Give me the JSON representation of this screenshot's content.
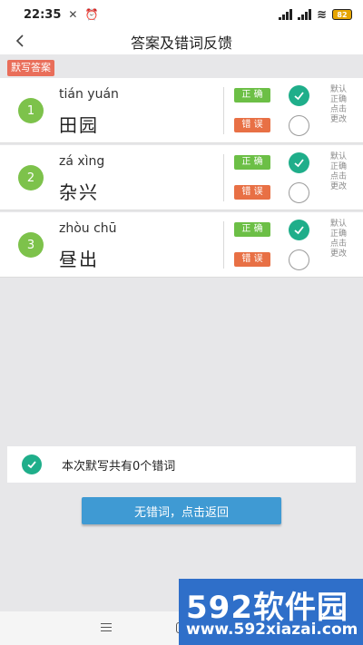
{
  "status_bar": {
    "time": "22:35",
    "battery": "82"
  },
  "header": {
    "title": "答案及错词反馈"
  },
  "section_tag": "默写答案",
  "words": [
    {
      "number": "1",
      "pinyin": "tián yuán",
      "hanzi": "田园",
      "correct_label": "正 确",
      "wrong_label": "错 误",
      "hint": "默认正确点击更改"
    },
    {
      "number": "2",
      "pinyin": "zá xìng",
      "hanzi": "杂兴",
      "correct_label": "正 确",
      "wrong_label": "错 误",
      "hint": "默认正确点击更改"
    },
    {
      "number": "3",
      "pinyin": "zhòu chū",
      "hanzi": "昼出",
      "correct_label": "正 确",
      "wrong_label": "错 误",
      "hint": "默认正确点击更改"
    }
  ],
  "summary": {
    "text": "本次默写共有0个错词"
  },
  "return_button": {
    "label": "无错词，点击返回"
  },
  "watermark": {
    "logo": "592软件园",
    "site": "www.592xiazai.com"
  },
  "colors": {
    "accent_teal": "#1fae8a",
    "correct_green": "#6cbf46",
    "wrong_orange": "#e87045",
    "button_blue": "#3f9ad3",
    "number_green": "#7dc24b",
    "tag_red": "#e96e5a"
  },
  "icons": {
    "back": "chevron-left-icon",
    "selected": "check-circle-icon",
    "unselected": "empty-circle-icon"
  }
}
